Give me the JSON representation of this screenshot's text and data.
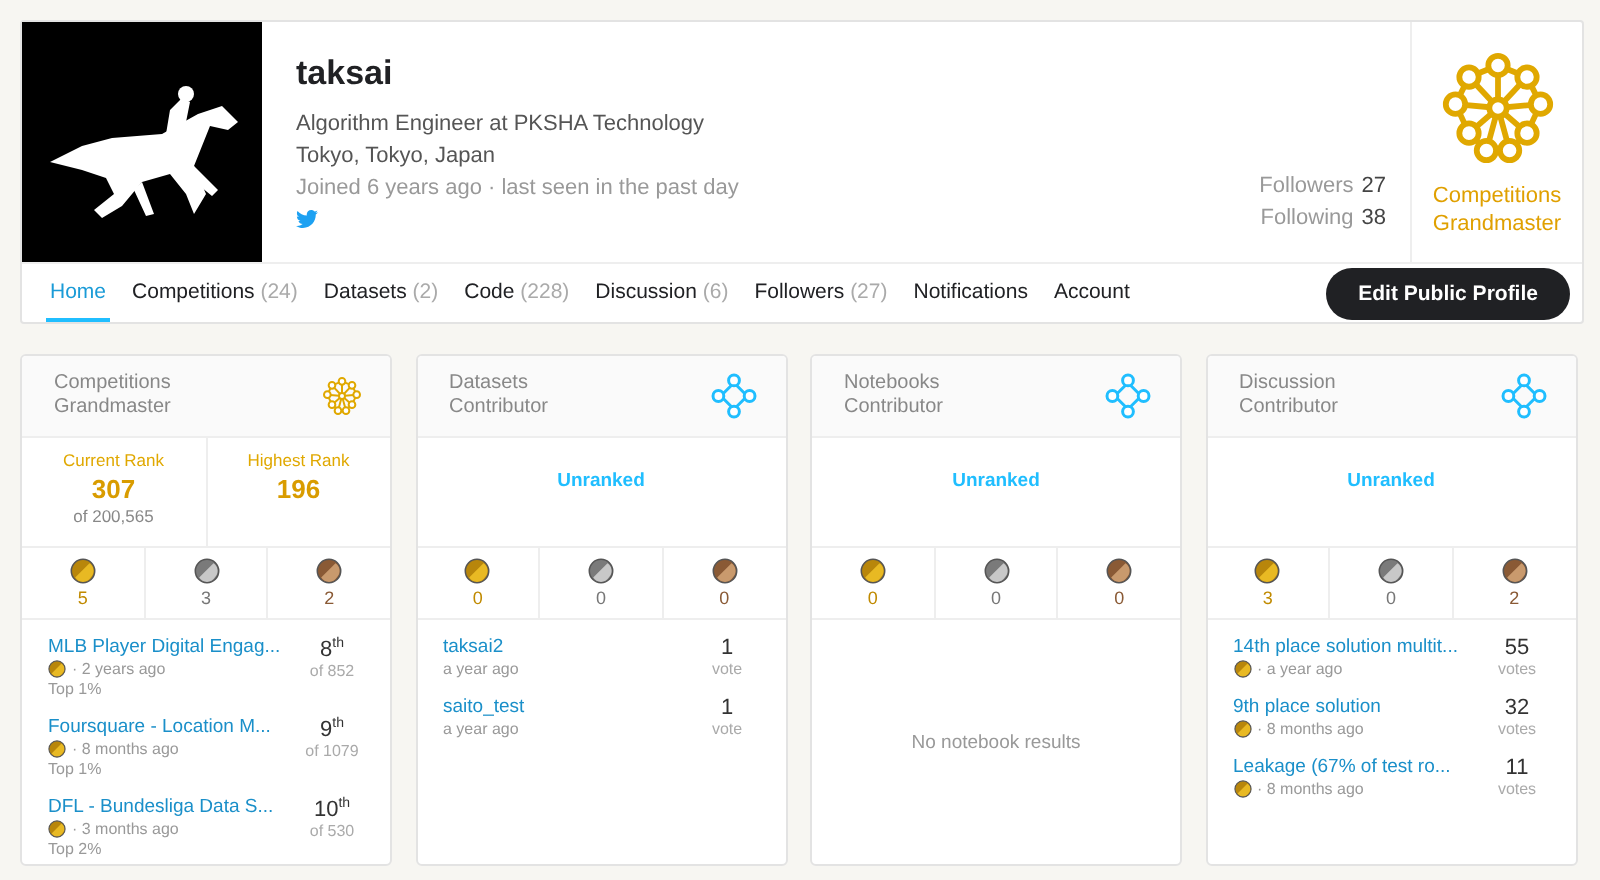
{
  "profile": {
    "name": "taksai",
    "occupation": "Algorithm Engineer at PKSHA Technology",
    "location": "Tokyo, Tokyo, Japan",
    "joined": "Joined 6 years ago · last seen in the past day",
    "stats": [
      {
        "label": "Followers",
        "value": "27"
      },
      {
        "label": "Following",
        "value": "38"
      }
    ],
    "badge": {
      "kind": "grandmaster",
      "label": "Competitions Grandmaster"
    }
  },
  "tabs": [
    {
      "label": "Home",
      "selected": true
    },
    {
      "label": "Competitions",
      "count": "(24)",
      "selected": false
    },
    {
      "label": "Datasets",
      "count": "(2)",
      "selected": false
    },
    {
      "label": "Code",
      "count": "(228)",
      "selected": false
    },
    {
      "label": "Discussion",
      "count": "(6)",
      "selected": false
    },
    {
      "label": "Followers",
      "count": "(27)",
      "selected": false
    },
    {
      "label": "Notifications",
      "selected": false
    },
    {
      "label": "Account",
      "selected": false
    }
  ],
  "edit_button": "Edit Public Profile",
  "cards": [
    {
      "title": "Competitions Grandmaster",
      "kind": "grandmaster",
      "ranks": [
        {
          "label": "Current Rank",
          "value": "307",
          "of": "of 200,565"
        },
        {
          "label": "Highest Rank",
          "value": "196"
        }
      ],
      "medals": [
        {
          "kind": "gold",
          "count": "5"
        },
        {
          "kind": "silver",
          "count": "3"
        },
        {
          "kind": "bronze",
          "count": "2"
        }
      ],
      "items": [
        {
          "title": "MLB Player Digital Engag...",
          "medal": {
            "kind": "gold"
          },
          "time": "· 2 years ago",
          "note": "Top 1%",
          "value": "8$^{th}$",
          "sub": "of 852"
        },
        {
          "title": "Foursquare - Location M...",
          "medal": {
            "kind": "gold"
          },
          "time": "· 8 months ago",
          "note": "Top 1%",
          "value": "9$^{th}$",
          "sub": "of 1079"
        },
        {
          "title": "DFL - Bundesliga Data S...",
          "medal": {
            "kind": "gold"
          },
          "time": "· 3 months ago",
          "note": "Top 2%",
          "value": "10$^{th}$",
          "sub": "of 530"
        }
      ]
    },
    {
      "title": "Datasets Contributor",
      "kind": "contributor",
      "unranked": "Unranked",
      "medals": [
        {
          "kind": "gold",
          "count": "0"
        },
        {
          "kind": "silver",
          "count": "0"
        },
        {
          "kind": "bronze",
          "count": "0"
        }
      ],
      "items": [
        {
          "title": "taksai2",
          "time": "a year ago",
          "value": "1",
          "sub": "vote"
        },
        {
          "title": "saito_test",
          "time": "a year ago",
          "value": "1",
          "sub": "vote"
        }
      ]
    },
    {
      "title": "Notebooks Contributor",
      "kind": "contributor",
      "unranked": "Unranked",
      "medals": [
        {
          "kind": "gold",
          "count": "0"
        },
        {
          "kind": "silver",
          "count": "0"
        },
        {
          "kind": "bronze",
          "count": "0"
        }
      ],
      "empty": "No notebook results"
    },
    {
      "title": "Discussion Contributor",
      "kind": "contributor",
      "unranked": "Unranked",
      "medals": [
        {
          "kind": "gold",
          "count": "3"
        },
        {
          "kind": "silver",
          "count": "0"
        },
        {
          "kind": "bronze",
          "count": "2"
        }
      ],
      "items": [
        {
          "title": "14th place solution multit...",
          "medal": {
            "kind": "gold"
          },
          "time": "· a year ago",
          "value": "55",
          "sub": "votes"
        },
        {
          "title": "9th place solution",
          "medal": {
            "kind": "gold"
          },
          "time": "· 8 months ago",
          "value": "32",
          "sub": "votes"
        },
        {
          "title": "Leakage (67% of test ro...",
          "medal": {
            "kind": "gold"
          },
          "time": "· 8 months ago",
          "value": "11",
          "sub": "votes"
        }
      ]
    }
  ]
}
